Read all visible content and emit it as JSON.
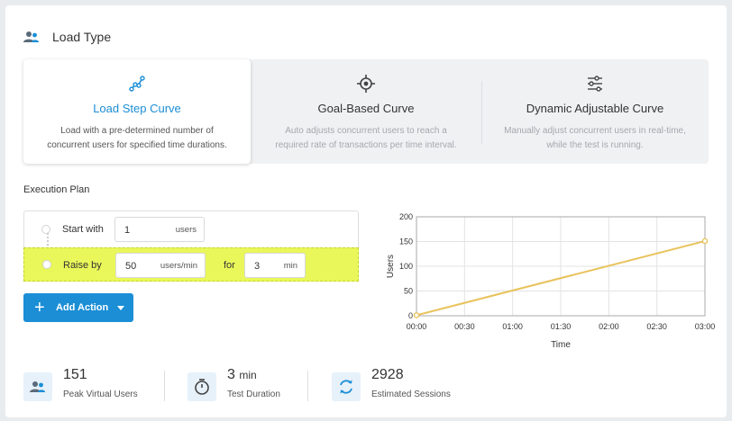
{
  "header": {
    "title": "Load Type",
    "icon": "users-icon"
  },
  "curves": [
    {
      "name": "Load Step Curve",
      "desc_line1": "Load with a pre-determined number of",
      "desc_line2": "concurrent users for specified time durations.",
      "icon": "step-curve-icon",
      "selected": true
    },
    {
      "name": "Goal-Based Curve",
      "desc_line1": "Auto adjusts concurrent users to reach a",
      "desc_line2": "required rate of transactions per time interval.",
      "icon": "target-icon",
      "selected": false
    },
    {
      "name": "Dynamic Adjustable Curve",
      "desc_line1": "Manually adjust concurrent users in real-time,",
      "desc_line2": "while the test is running.",
      "icon": "sliders-icon",
      "selected": false
    }
  ],
  "execution_plan": {
    "label": "Execution Plan",
    "start": {
      "label": "Start with",
      "value": "1",
      "unit": "users"
    },
    "raise": {
      "label": "Raise by",
      "value": "50",
      "unit": "users/min",
      "for_label": "for",
      "for_value": "3",
      "for_unit": "min"
    },
    "add_action_label": "Add Action"
  },
  "chart_data": {
    "type": "line",
    "xlabel": "Time",
    "ylabel": "Users",
    "x_ticks": [
      "00:00",
      "00:30",
      "01:00",
      "01:30",
      "02:00",
      "02:30",
      "03:00"
    ],
    "y_ticks": [
      "0",
      "50",
      "100",
      "150",
      "200"
    ],
    "ylim": [
      0,
      200
    ],
    "x_minutes": [
      0,
      3
    ],
    "series": [
      {
        "values": [
          1,
          151
        ],
        "color": "#e8c25a"
      }
    ],
    "grid": true
  },
  "stats": [
    {
      "value": "151",
      "unit": "",
      "caption": "Peak Virtual Users",
      "icon": "users-icon"
    },
    {
      "value": "3",
      "unit": "min",
      "caption": "Test Duration",
      "icon": "stopwatch-icon"
    },
    {
      "value": "2928",
      "unit": "",
      "caption": "Estimated Sessions",
      "icon": "refresh-icon"
    }
  ],
  "colors": {
    "accent": "#1b8ed6",
    "highlight": "#eaf75a",
    "line": "#e8c25a"
  }
}
